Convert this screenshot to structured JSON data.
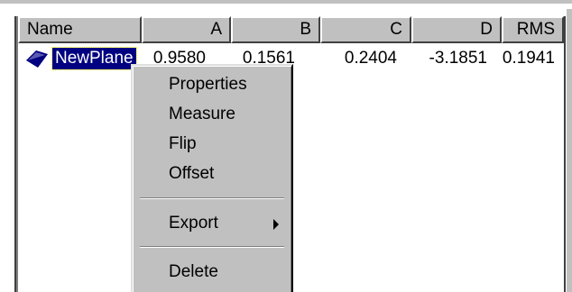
{
  "table": {
    "columns": [
      "Name",
      "A",
      "B",
      "C",
      "D",
      "RMS"
    ],
    "rows": [
      {
        "name": "NewPlane",
        "a": "0.9580",
        "b": "0.1561",
        "c": "0.2404",
        "d": "-3.1851",
        "rms": "0.1941"
      }
    ],
    "row_icon": "plane-icon"
  },
  "context_menu": {
    "items": [
      "Properties",
      "Measure",
      "Flip",
      "Offset",
      "Export",
      "Delete"
    ],
    "submenu_icon": "arrow-right-icon"
  },
  "colors": {
    "selection": "#000080",
    "face": "#c0c0c0",
    "plane_icon": "#000080"
  }
}
